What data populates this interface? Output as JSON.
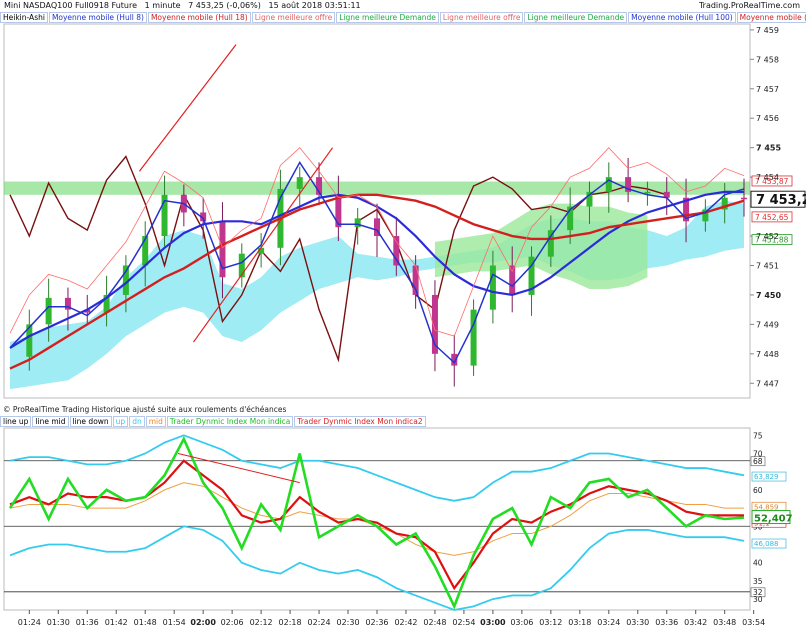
{
  "header": {
    "instrument": "Mini NASDAQ100 Full0918 Future",
    "interval": "1 minute",
    "change": "7 453,25 (-0,06%)",
    "datetime": "15 août 2018 03:51:11",
    "site": "Trading.ProRealTime.com"
  },
  "legend_top": [
    {
      "label": "Heikin-Ashi",
      "color": "#000000"
    },
    {
      "label": "Moyenne mobile (Hull 8)",
      "color": "#2233cc"
    },
    {
      "label": "Moyenne mobile (Hull 18)",
      "color": "#cc2222"
    },
    {
      "label": "Ligne meilleure offre",
      "color": "#dd6666"
    },
    {
      "label": "Ligne meilleure Demande",
      "color": "#22aa44"
    },
    {
      "label": "Ligne meilleure offre",
      "color": "#dd6666"
    },
    {
      "label": "Ligne meilleure Demande",
      "color": "#22aa44"
    },
    {
      "label": "Moyenne mobile (Hull 100)",
      "color": "#2233cc"
    },
    {
      "label": "Moyenne mobile (Hull 200)",
      "color": "#cc2222"
    }
  ],
  "note": "© ProRealTime Trading Historique ajusté suite aux roulements d'échéances",
  "legend_bottom": [
    {
      "label": "line up",
      "color": "#000000"
    },
    {
      "label": "line mid",
      "color": "#000000"
    },
    {
      "label": "line down",
      "color": "#000000"
    },
    {
      "label": "up",
      "color": "#33ccee"
    },
    {
      "label": "dn",
      "color": "#33ccee"
    },
    {
      "label": "mid",
      "color": "#ee8822"
    },
    {
      "label": "Trader Dynmic Index Mon indica",
      "color": "#22bb22"
    },
    {
      "label": "Trader Dynmic Index Mon indica2",
      "color": "#dd2222"
    }
  ],
  "price_axis": {
    "ticks": [
      "7 459",
      "7 458",
      "7 457",
      "7 456",
      "7 455",
      "7 454",
      "7 453",
      "7 452",
      "7 451",
      "7 450",
      "7 449",
      "7 448",
      "7 447"
    ],
    "current_main": "7 453,2",
    "current_sup": "5",
    "labels": {
      "a": "7 453,87",
      "b": "7 452,65",
      "c": "7 451,88"
    }
  },
  "indicator_axis": {
    "ticks": [
      "75",
      "70",
      "68",
      "60",
      "55",
      "50",
      "45",
      "40",
      "35",
      "32",
      "30"
    ],
    "labels": {
      "up": "63,829",
      "mid": "54,859",
      "main": "52,407",
      "dn": "46,088",
      "sig": "51,1"
    }
  },
  "time_axis": {
    "ticks": [
      "01:24",
      "01:30",
      "01:36",
      "01:42",
      "01:48",
      "01:54",
      "02:00",
      "02:06",
      "02:12",
      "02:18",
      "02:24",
      "02:30",
      "02:36",
      "02:42",
      "02:48",
      "02:54",
      "03:00",
      "03:06",
      "03:12",
      "03:18",
      "03:24",
      "03:30",
      "03:36",
      "03:42",
      "03:48",
      "03:54"
    ],
    "bold": [
      "02:00",
      "03:00"
    ]
  },
  "colors": {
    "ichimoku_cyan": "#7fe6f0",
    "ichimoku_green": "#9be89b",
    "hull8": "#2233cc",
    "hull18": "#cc2222",
    "hull100": "#2b2bd9",
    "hull200": "#d41f1f",
    "offer": "#ff6b6b",
    "chikou": "#7a1010",
    "tdi_main": "#22dd22",
    "tdi_signal": "#dd1111",
    "tdi_band": "#33ccee",
    "tdi_mid": "#f0a040"
  },
  "chart_data": [
    {
      "type": "line",
      "title": "Mini NASDAQ100 Full0918 Future — 1 minute",
      "time": [
        "01:20",
        "01:24",
        "01:28",
        "01:32",
        "01:36",
        "01:40",
        "01:44",
        "01:48",
        "01:52",
        "01:56",
        "02:00",
        "02:04",
        "02:08",
        "02:12",
        "02:16",
        "02:20",
        "02:24",
        "02:28",
        "02:32",
        "02:36",
        "02:40",
        "02:44",
        "02:48",
        "02:52",
        "02:56",
        "03:00",
        "03:04",
        "03:08",
        "03:12",
        "03:16",
        "03:20",
        "03:24",
        "03:28",
        "03:32",
        "03:36",
        "03:40",
        "03:44",
        "03:48",
        "03:52"
      ],
      "ylim": [
        7446.5,
        7459.2
      ],
      "series": [
        {
          "name": "Heikin-Ashi",
          "values": [
            7447.9,
            7449.0,
            7449.9,
            7449.5,
            7449.4,
            7450.0,
            7451.0,
            7452.0,
            7453.4,
            7452.8,
            7452.5,
            7450.6,
            7451.4,
            7451.6,
            7453.6,
            7454.0,
            7453.4,
            7452.3,
            7452.6,
            7452.0,
            7451.0,
            7450.0,
            7448.0,
            7447.6,
            7449.5,
            7451.0,
            7450.0,
            7451.3,
            7452.2,
            7453.0,
            7453.5,
            7454.0,
            7453.5,
            7453.5,
            7453.3,
            7452.5,
            7452.9,
            7453.3,
            7453.25
          ]
        },
        {
          "name": "Moyenne mobile (Hull 8)",
          "values": [
            7448.2,
            7448.9,
            7449.6,
            7449.6,
            7449.3,
            7449.9,
            7450.8,
            7451.9,
            7453.2,
            7453.1,
            7452.6,
            7450.9,
            7451.1,
            7451.7,
            7453.3,
            7454.5,
            7453.5,
            7452.4,
            7452.4,
            7452.2,
            7451.2,
            7450.2,
            7448.3,
            7447.7,
            7449.0,
            7450.7,
            7450.3,
            7451.0,
            7452.0,
            7452.9,
            7453.4,
            7453.9,
            7453.6,
            7453.4,
            7453.3,
            7452.6,
            7452.8,
            7453.4,
            7453.6
          ]
        },
        {
          "name": "Moyenne mobile (Hull 100)",
          "values": [
            7448.2,
            7448.6,
            7448.9,
            7449.2,
            7449.5,
            7449.9,
            7450.4,
            7451.0,
            7451.6,
            7452.1,
            7452.4,
            7452.5,
            7452.5,
            7452.4,
            7452.7,
            7453.0,
            7453.3,
            7453.4,
            7453.3,
            7453.0,
            7452.6,
            7452.0,
            7451.3,
            7450.7,
            7450.3,
            7450.1,
            7450.0,
            7450.2,
            7450.6,
            7451.1,
            7451.6,
            7452.1,
            7452.5,
            7452.8,
            7453.0,
            7453.2,
            7453.4,
            7453.5,
            7453.5
          ]
        },
        {
          "name": "Moyenne mobile (Hull 200)",
          "values": [
            7447.5,
            7447.8,
            7448.2,
            7448.6,
            7449.0,
            7449.4,
            7449.8,
            7450.2,
            7450.6,
            7450.9,
            7451.3,
            7451.7,
            7452.0,
            7452.3,
            7452.6,
            7452.9,
            7453.1,
            7453.3,
            7453.4,
            7453.4,
            7453.3,
            7453.2,
            7453.0,
            7452.7,
            7452.4,
            7452.2,
            7452.0,
            7451.9,
            7451.9,
            7452.0,
            7452.1,
            7452.3,
            7452.4,
            7452.5,
            7452.6,
            7452.7,
            7452.8,
            7453.0,
            7453.2
          ]
        }
      ]
    },
    {
      "type": "line",
      "title": "Trader Dynmic Index",
      "time": [
        "01:20",
        "01:24",
        "01:28",
        "01:32",
        "01:36",
        "01:40",
        "01:44",
        "01:48",
        "01:52",
        "01:56",
        "02:00",
        "02:04",
        "02:08",
        "02:12",
        "02:16",
        "02:20",
        "02:24",
        "02:28",
        "02:32",
        "02:36",
        "02:40",
        "02:44",
        "02:48",
        "02:52",
        "02:56",
        "03:00",
        "03:04",
        "03:08",
        "03:12",
        "03:16",
        "03:20",
        "03:24",
        "03:28",
        "03:32",
        "03:36",
        "03:40",
        "03:44",
        "03:48",
        "03:52"
      ],
      "ylim": [
        27,
        77
      ],
      "series": [
        {
          "name": "Trader Dynmic Index Mon indica",
          "values": [
            55,
            63,
            52,
            63,
            55,
            60,
            57,
            58,
            64,
            74,
            62,
            55,
            44,
            56,
            49,
            70,
            47,
            50,
            53,
            50,
            45,
            48,
            39,
            28,
            42,
            52,
            55,
            45,
            58,
            55,
            62,
            63,
            58,
            60,
            55,
            50,
            53,
            52,
            52.4
          ]
        },
        {
          "name": "Trader Dynmic Index Mon indica2",
          "values": [
            56,
            58,
            56,
            59,
            58,
            58,
            57,
            58,
            62,
            68,
            64,
            60,
            53,
            51,
            52,
            58,
            54,
            51,
            52,
            51,
            48,
            47,
            43,
            33,
            40,
            48,
            52,
            51,
            54,
            56,
            59,
            61,
            60,
            59,
            57,
            54,
            53,
            53,
            53
          ]
        },
        {
          "name": "up",
          "values": [
            68,
            69,
            69,
            68,
            67,
            67,
            68,
            70,
            73,
            75,
            73,
            71,
            68,
            67,
            66,
            68,
            68,
            67,
            66,
            64,
            62,
            60,
            58,
            57,
            58,
            62,
            65,
            65,
            66,
            68,
            70,
            70,
            69,
            68,
            67,
            66,
            66,
            65,
            64
          ]
        },
        {
          "name": "dn",
          "values": [
            42,
            44,
            45,
            45,
            44,
            43,
            43,
            44,
            47,
            50,
            49,
            46,
            40,
            38,
            37,
            40,
            38,
            37,
            38,
            36,
            33,
            31,
            29,
            27,
            28,
            30,
            31,
            31,
            33,
            38,
            44,
            48,
            49,
            49,
            48,
            47,
            47,
            47,
            46
          ]
        },
        {
          "name": "mid",
          "values": [
            55,
            56,
            56,
            56,
            55,
            55,
            55,
            57,
            60,
            62,
            61,
            58,
            55,
            53,
            52,
            54,
            53,
            52,
            52,
            50,
            48,
            45,
            43,
            42,
            43,
            46,
            48,
            48,
            50,
            53,
            57,
            59,
            59,
            58,
            57,
            56,
            56,
            55,
            55
          ]
        }
      ],
      "levels": [
        68,
        50,
        32
      ]
    }
  ]
}
